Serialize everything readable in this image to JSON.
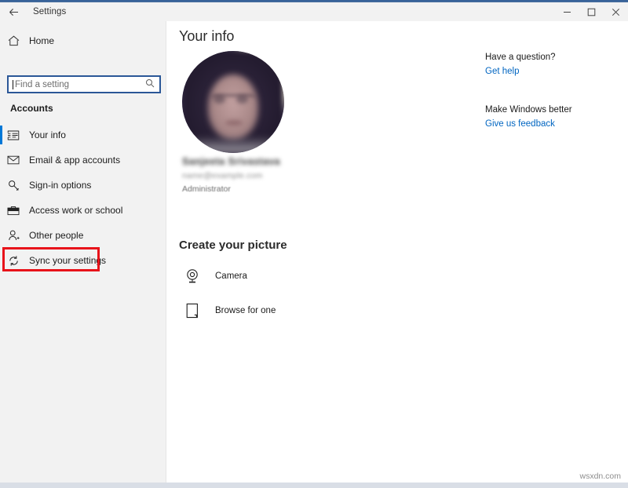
{
  "window": {
    "title": "Settings",
    "back_icon": "back-arrow-icon",
    "controls": {
      "minimize": "minimize-icon",
      "maximize": "maximize-icon",
      "close": "close-icon"
    }
  },
  "sidebar": {
    "home_label": "Home",
    "home_icon": "home-icon",
    "search": {
      "placeholder": "Find a setting",
      "value": "",
      "icon": "search-icon"
    },
    "group_title": "Accounts",
    "items": [
      {
        "label": "Your info",
        "icon": "contact-card-icon",
        "selected": true
      },
      {
        "label": "Email & app accounts",
        "icon": "envelope-icon",
        "selected": false
      },
      {
        "label": "Sign-in options",
        "icon": "key-icon",
        "selected": false
      },
      {
        "label": "Access work or school",
        "icon": "briefcase-icon",
        "selected": false
      },
      {
        "label": "Other people",
        "icon": "person-add-icon",
        "selected": false
      },
      {
        "label": "Sync your settings",
        "icon": "sync-icon",
        "selected": false
      }
    ],
    "highlight": {
      "target_label": "Sync your settings",
      "color": "#e8131a"
    }
  },
  "main": {
    "page_title": "Your info",
    "avatar": {
      "name": "avatar-image",
      "description": "blurred profile photo"
    },
    "account": {
      "name": "Sanjeeta Srivastava",
      "email": "name@example.com",
      "role": "Administrator"
    },
    "create_picture": {
      "title": "Create your picture",
      "options": [
        {
          "label": "Camera",
          "icon": "camera-icon"
        },
        {
          "label": "Browse for one",
          "icon": "browse-file-icon"
        }
      ]
    }
  },
  "help": {
    "question_heading": "Have a question?",
    "question_link": "Get help",
    "feedback_heading": "Make Windows better",
    "feedback_link": "Give us feedback"
  },
  "watermark": "wsxdn.com",
  "colors": {
    "accent": "#0078d7",
    "link": "#0065c1",
    "sidebar_bg": "#f2f2f2",
    "highlight": "#e8131a"
  }
}
